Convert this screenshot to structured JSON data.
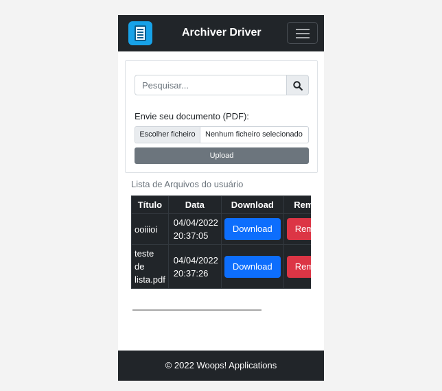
{
  "navbar": {
    "brand": "Archiver Driver",
    "logo_icon": "document-app-icon",
    "toggle_icon": "hamburger-menu-icon"
  },
  "search": {
    "placeholder": "Pesquisar...",
    "value": "",
    "button_icon": "search-icon"
  },
  "upload": {
    "label": "Envie seu documento (PDF):",
    "file_button": "Escolher ficheiro",
    "file_status": "Nenhum ficheiro selecionado",
    "submit_label": "Upload"
  },
  "files": {
    "title": "Lista de Arquivos do usuário",
    "columns": [
      "Título",
      "Data",
      "Download",
      "Remover"
    ],
    "rows": [
      {
        "title": "ooiiioi",
        "date": "04/04/2022",
        "time": "20:37:05",
        "download": "Download",
        "remove": "Remover"
      },
      {
        "title": "teste de lista.pdf",
        "date": "04/04/2022",
        "time": "20:37:26",
        "download": "Download",
        "remove": "Remover"
      }
    ]
  },
  "footer": {
    "text": "© 2022 Woops! Applications"
  },
  "colors": {
    "navbar": "#212529",
    "primary": "#0d6efd",
    "danger": "#dc3545",
    "secondary": "#6c757d",
    "logo": "#17a2e8"
  }
}
